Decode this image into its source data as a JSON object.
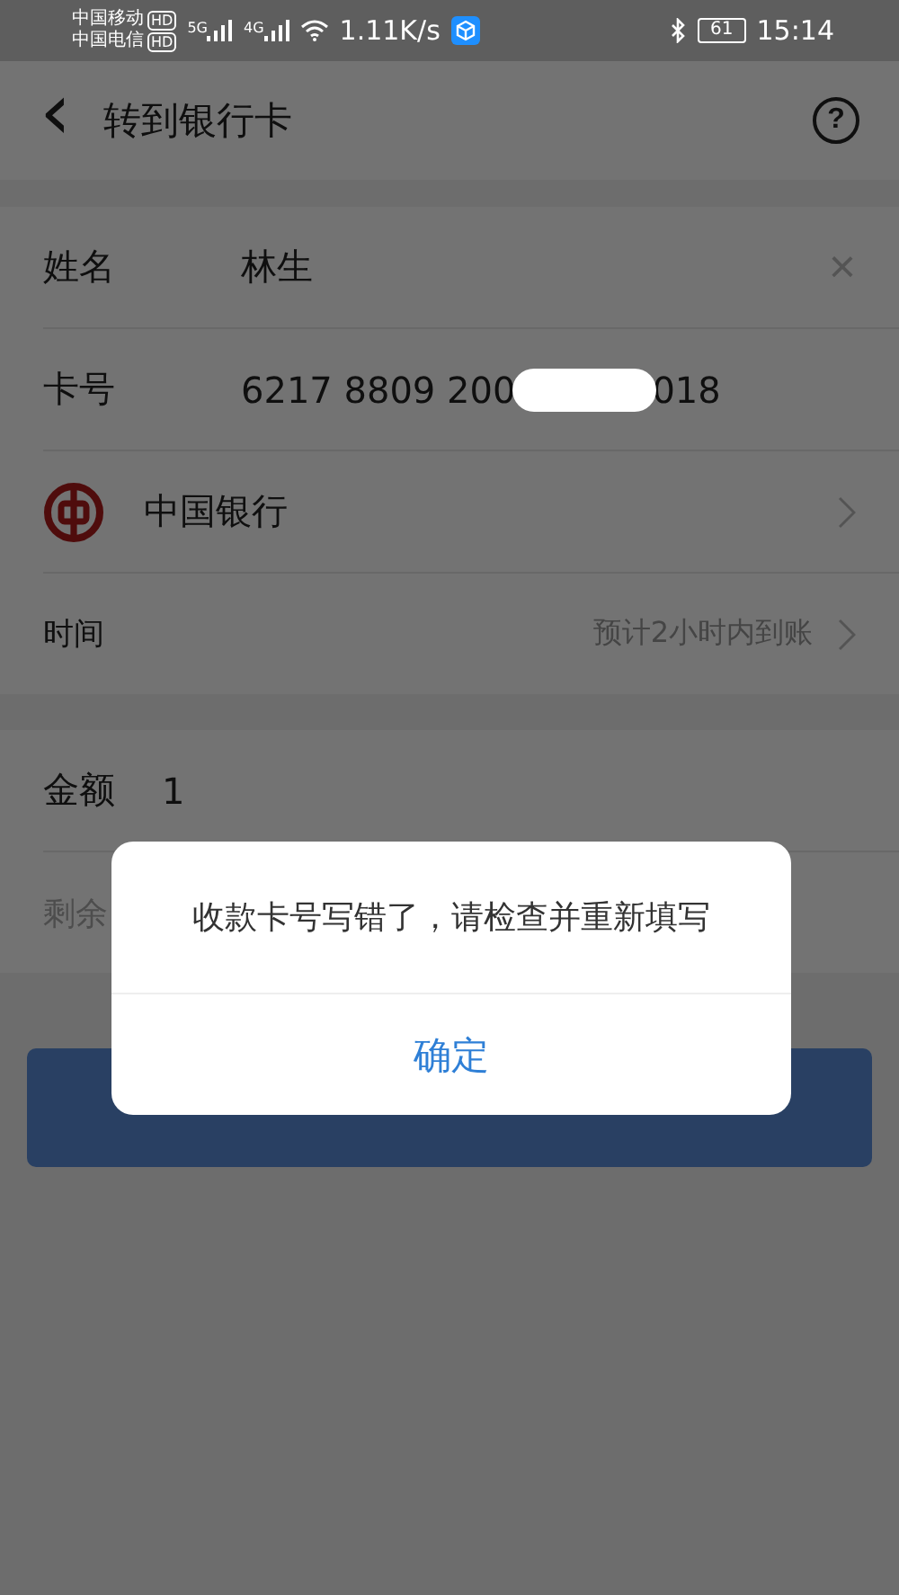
{
  "status_bar": {
    "carriers": [
      {
        "name": "中国移动",
        "badge": "HD"
      },
      {
        "name": "中国电信",
        "badge": "HD"
      }
    ],
    "signals": [
      {
        "label": "5G"
      },
      {
        "label": "4G"
      }
    ],
    "speed": "1.11K/s",
    "battery": "61",
    "time": "15:14"
  },
  "header": {
    "back": "‹",
    "title": "转到银行卡",
    "help": "?"
  },
  "recipient": {
    "rows": [
      {
        "kind": "name",
        "label": "姓名",
        "value": "林生",
        "clear": "×"
      },
      {
        "kind": "card",
        "label": "卡号",
        "value_start": "6217 8809 200",
        "value_end": "018"
      },
      {
        "kind": "bank",
        "value": "中国银行"
      },
      {
        "kind": "time",
        "label": "时间",
        "value": "预计2小时内到账"
      }
    ]
  },
  "amount": {
    "label": "金额",
    "value": "1",
    "remaining": "剩余"
  },
  "next_button": {
    "disabled": false
  },
  "dialog": {
    "message": "收款卡号写错了，请检查并重新填写",
    "confirm": "确定"
  }
}
